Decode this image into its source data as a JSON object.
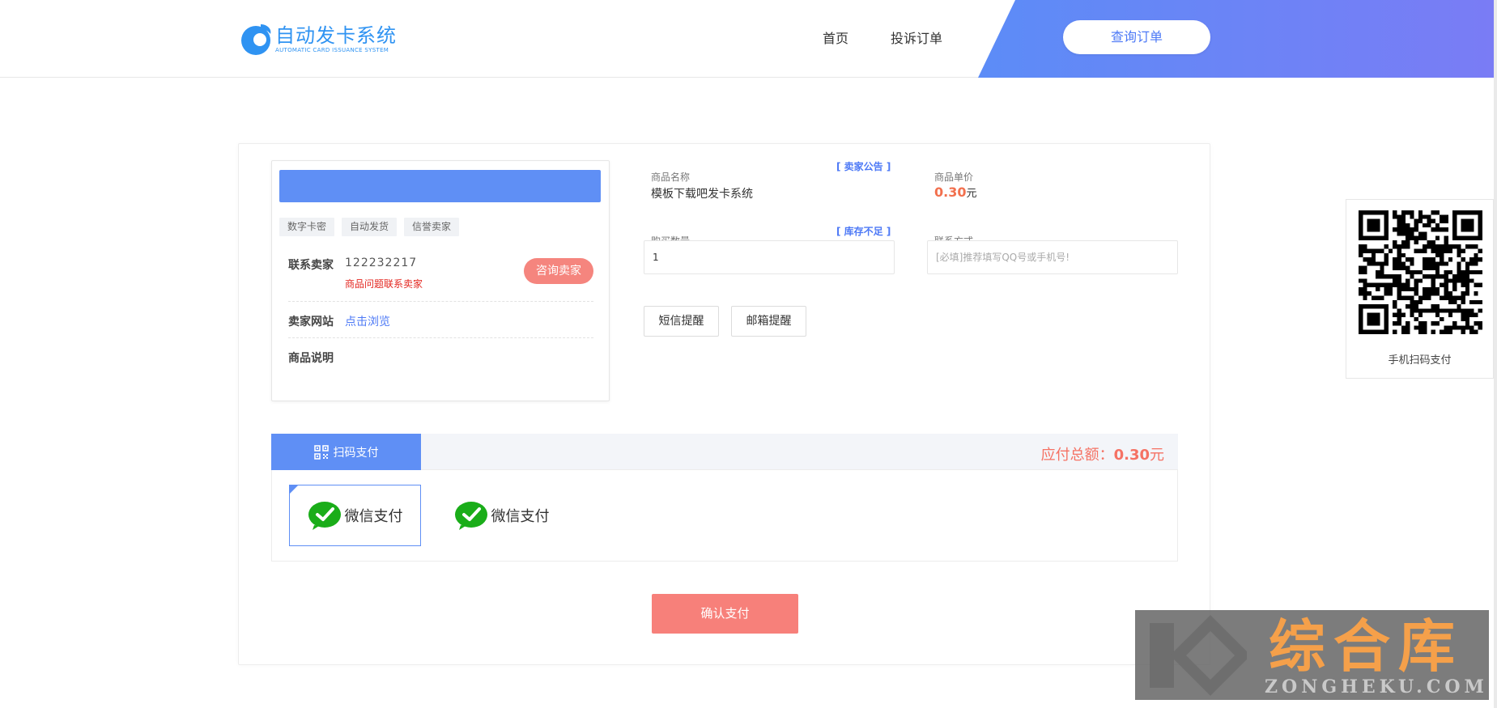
{
  "header": {
    "logo_title": "自动发卡系统",
    "logo_subtitle": "AUTOMATIC CARD ISSUANCE SYSTEM",
    "nav": [
      "首页",
      "投诉订单"
    ],
    "query_button": "查询订单"
  },
  "seller_card": {
    "tags": [
      "数字卡密",
      "自动发货",
      "信誉卖家"
    ],
    "contact_label": "联系卖家",
    "contact_value": "122232217",
    "contact_warning": "商品问题联系卖家",
    "consult_button": "咨询卖家",
    "site_label": "卖家网站",
    "site_link": "点击浏览",
    "desc_label": "商品说明"
  },
  "product": {
    "notice_link": "[ 卖家公告 ]",
    "name_label": "商品名称",
    "name_value": "模板下载吧发卡系统",
    "price_label": "商品单价",
    "price_value": "0.30",
    "price_unit": "元",
    "stock_link": "[ 库存不足 ]",
    "qty_label": "购买数量",
    "qty_value": "1",
    "contact_label": "联系方式",
    "contact_placeholder": "[必填]推荐填写QQ号或手机号!",
    "sms_button": "短信提醒",
    "email_button": "邮箱提醒"
  },
  "payment": {
    "tab_label": "扫码支付",
    "total_label": "应付总额：",
    "total_value": "0.30",
    "total_unit": "元",
    "options": [
      "微信支付",
      "微信支付"
    ],
    "confirm_button": "确认支付"
  },
  "qr": {
    "caption": "手机扫码支付"
  },
  "watermark": {
    "cn": "综合库",
    "en": "ZONGHEKU.COM"
  },
  "colors": {
    "primary": "#5f8ff5",
    "accent_red": "#f7807a",
    "price_orange": "#f2704e",
    "wechat_green": "#1aad19"
  }
}
